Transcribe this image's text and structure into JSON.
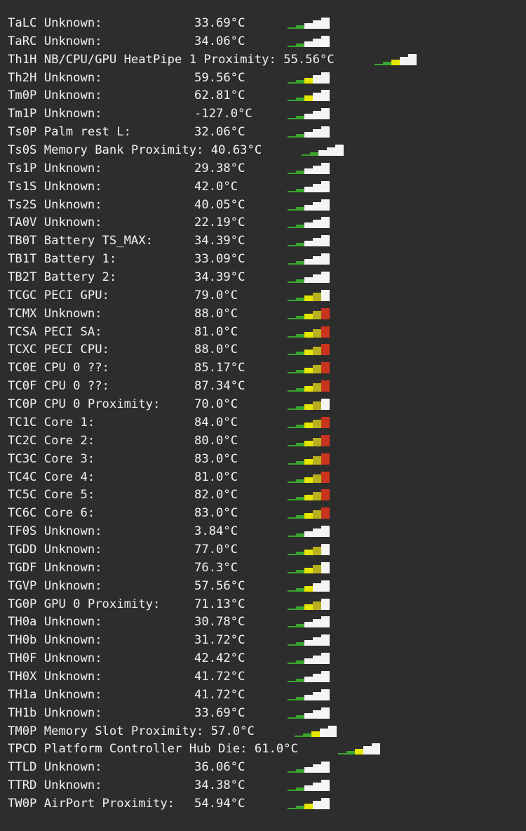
{
  "colors": {
    "background": "#2d2d2d",
    "text": "#f2f2f2",
    "meter_green": "#3aa52f",
    "meter_yellow": "#e6e600",
    "meter_olive": "#b8b01c",
    "meter_red": "#c8341e",
    "meter_white": "#f5f5f5"
  },
  "sensors": [
    {
      "code": "TaLC",
      "label": "Unknown:",
      "temp": "33.69°C",
      "level": 2
    },
    {
      "code": "TaRC",
      "label": "Unknown:",
      "temp": "34.06°C",
      "level": 2
    },
    {
      "code": "Th1H",
      "label": "NB/CPU/GPU HeatPipe 1 Proximity:",
      "temp": "55.56°C",
      "level": 3
    },
    {
      "code": "Th2H",
      "label": "Unknown:",
      "temp": "59.56°C",
      "level": 3
    },
    {
      "code": "Tm0P",
      "label": "Unknown:",
      "temp": "62.81°C",
      "level": 3
    },
    {
      "code": "Tm1P",
      "label": "Unknown:",
      "temp": "-127.0°C",
      "level": 2
    },
    {
      "code": "Ts0P",
      "label": "Palm rest L:",
      "temp": "32.06°C",
      "level": 2
    },
    {
      "code": "Ts0S",
      "label": "Memory Bank Proximity:",
      "temp": "40.63°C",
      "level": 2
    },
    {
      "code": "Ts1P",
      "label": "Unknown:",
      "temp": "29.38°C",
      "level": 2
    },
    {
      "code": "Ts1S",
      "label": "Unknown:",
      "temp": "42.0°C",
      "level": 2
    },
    {
      "code": "Ts2S",
      "label": "Unknown:",
      "temp": "40.05°C",
      "level": 2
    },
    {
      "code": "TA0V",
      "label": "Unknown:",
      "temp": "22.19°C",
      "level": 2
    },
    {
      "code": "TB0T",
      "label": "Battery TS_MAX:",
      "temp": "34.39°C",
      "level": 2
    },
    {
      "code": "TB1T",
      "label": "Battery 1:",
      "temp": "33.09°C",
      "level": 2
    },
    {
      "code": "TB2T",
      "label": "Battery 2:",
      "temp": "34.39°C",
      "level": 2
    },
    {
      "code": "TCGC",
      "label": "PECI GPU:",
      "temp": "79.0°C",
      "level": 4
    },
    {
      "code": "TCMX",
      "label": "Unknown:",
      "temp": "88.0°C",
      "level": 5
    },
    {
      "code": "TCSA",
      "label": "PECI SA:",
      "temp": "81.0°C",
      "level": 5
    },
    {
      "code": "TCXC",
      "label": "PECI CPU:",
      "temp": "88.0°C",
      "level": 5
    },
    {
      "code": "TC0E",
      "label": "CPU 0 ??:",
      "temp": "85.17°C",
      "level": 5
    },
    {
      "code": "TC0F",
      "label": "CPU 0 ??:",
      "temp": "87.34°C",
      "level": 5
    },
    {
      "code": "TC0P",
      "label": "CPU 0 Proximity:",
      "temp": "70.0°C",
      "level": 4
    },
    {
      "code": "TC1C",
      "label": "Core 1:",
      "temp": "84.0°C",
      "level": 5
    },
    {
      "code": "TC2C",
      "label": "Core 2:",
      "temp": "80.0°C",
      "level": 5
    },
    {
      "code": "TC3C",
      "label": "Core 3:",
      "temp": "83.0°C",
      "level": 5
    },
    {
      "code": "TC4C",
      "label": "Core 4:",
      "temp": "81.0°C",
      "level": 5
    },
    {
      "code": "TC5C",
      "label": "Core 5:",
      "temp": "82.0°C",
      "level": 5
    },
    {
      "code": "TC6C",
      "label": "Core 6:",
      "temp": "83.0°C",
      "level": 5
    },
    {
      "code": "TF0S",
      "label": "Unknown:",
      "temp": "3.84°C",
      "level": 2
    },
    {
      "code": "TGDD",
      "label": "Unknown:",
      "temp": "77.0°C",
      "level": 4
    },
    {
      "code": "TGDF",
      "label": "Unknown:",
      "temp": "76.3°C",
      "level": 4
    },
    {
      "code": "TGVP",
      "label": "Unknown:",
      "temp": "57.56°C",
      "level": 3
    },
    {
      "code": "TG0P",
      "label": "GPU 0 Proximity:",
      "temp": "71.13°C",
      "level": 4
    },
    {
      "code": "TH0a",
      "label": "Unknown:",
      "temp": "30.78°C",
      "level": 2
    },
    {
      "code": "TH0b",
      "label": "Unknown:",
      "temp": "31.72°C",
      "level": 2
    },
    {
      "code": "TH0F",
      "label": "Unknown:",
      "temp": "42.42°C",
      "level": 2
    },
    {
      "code": "TH0X",
      "label": "Unknown:",
      "temp": "41.72°C",
      "level": 2
    },
    {
      "code": "TH1a",
      "label": "Unknown:",
      "temp": "41.72°C",
      "level": 2
    },
    {
      "code": "TH1b",
      "label": "Unknown:",
      "temp": "33.69°C",
      "level": 2
    },
    {
      "code": "TM0P",
      "label": "Memory Slot Proximity:",
      "temp": "57.0°C",
      "level": 3
    },
    {
      "code": "TPCD",
      "label": "Platform Controller Hub Die:",
      "temp": "61.0°C",
      "level": 3
    },
    {
      "code": "TTLD",
      "label": "Unknown:",
      "temp": "36.06°C",
      "level": 2
    },
    {
      "code": "TTRD",
      "label": "Unknown:",
      "temp": "34.38°C",
      "level": 2
    },
    {
      "code": "TW0P",
      "label": "AirPort Proximity:",
      "temp": "54.94°C",
      "level": 3
    }
  ]
}
